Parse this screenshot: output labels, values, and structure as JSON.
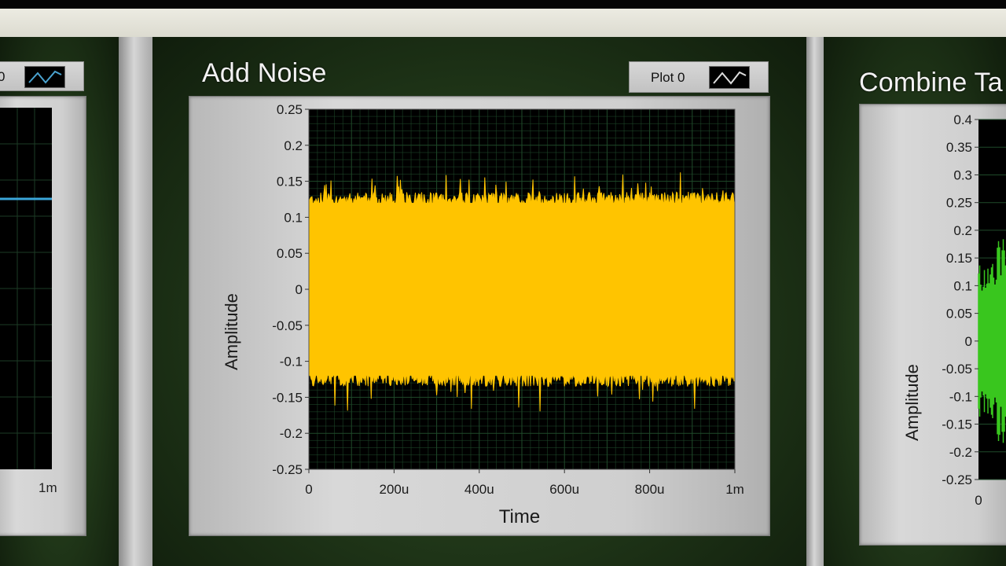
{
  "panels": {
    "left": {
      "legend_label": "0",
      "x_ticks": [
        {
          "v": 1,
          "label": "1m"
        }
      ]
    },
    "center": {
      "title": "Add Noise",
      "legend_label": "Plot 0",
      "xlabel": "Time",
      "ylabel": "Amplitude",
      "y_ticks": [
        "0.25",
        "0.2",
        "0.15",
        "0.1",
        "0.05",
        "0",
        "-0.05",
        "-0.1",
        "-0.15",
        "-0.2",
        "-0.25"
      ],
      "x_ticks": [
        "0",
        "200u",
        "400u",
        "600u",
        "800u",
        "1m"
      ],
      "plot_color": "#ffc400"
    },
    "right": {
      "title": "Combine Ta",
      "ylabel": "Amplitude",
      "y_ticks": [
        "0.4",
        "0.35",
        "0.3",
        "0.25",
        "0.2",
        "0.15",
        "0.1",
        "0.05",
        "0",
        "-0.05",
        "-0.1",
        "-0.15",
        "-0.2",
        "-0.25"
      ],
      "x_ticks": [
        "0"
      ],
      "plot_color": "#39c61e"
    }
  },
  "chart_data": [
    {
      "type": "line",
      "title": "Add Noise",
      "xlabel": "Time",
      "ylabel": "Amplitude",
      "xlim": [
        0,
        0.001
      ],
      "ylim": [
        -0.25,
        0.25
      ],
      "x_tick_labels": [
        "0",
        "200u",
        "400u",
        "600u",
        "800u",
        "1m"
      ],
      "grid": true,
      "legend": "top-right",
      "series": [
        {
          "name": "Plot 0",
          "color": "#ffc400",
          "envelope_upper": 0.12,
          "envelope_lower": -0.12,
          "peak_max": 0.16,
          "peak_min": -0.165
        }
      ]
    }
  ]
}
